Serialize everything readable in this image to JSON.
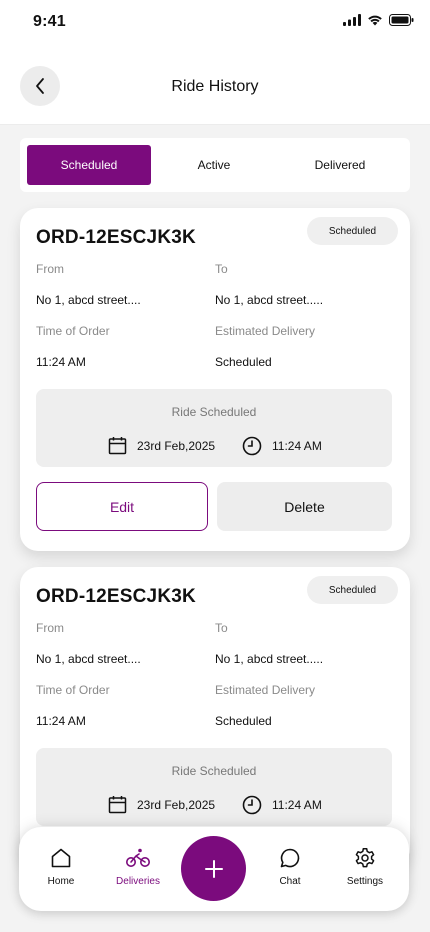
{
  "status_bar": {
    "time": "9:41"
  },
  "header": {
    "title": "Ride History"
  },
  "tabs": [
    {
      "label": "Scheduled",
      "active": true
    },
    {
      "label": "Active",
      "active": false
    },
    {
      "label": "Delivered",
      "active": false
    }
  ],
  "orders": [
    {
      "id": "ORD-12ESCJK3K",
      "status": "Scheduled",
      "from_label": "From",
      "from_value": "No 1, abcd street....",
      "to_label": "To",
      "to_value": "No 1, abcd street.....",
      "time_label": "Time of Order",
      "time_value": "11:24 AM",
      "delivery_label": "Estimated Delivery",
      "delivery_value": "Scheduled",
      "schedule_title": "Ride Scheduled",
      "schedule_date": "23rd Feb,2025",
      "schedule_time": "11:24 AM",
      "edit_label": "Edit",
      "delete_label": "Delete"
    },
    {
      "id": "ORD-12ESCJK3K",
      "status": "Scheduled",
      "from_label": "From",
      "from_value": "No 1, abcd street....",
      "to_label": "To",
      "to_value": "No 1, abcd street.....",
      "time_label": "Time of Order",
      "time_value": "11:24 AM",
      "delivery_label": "Estimated Delivery",
      "delivery_value": "Scheduled",
      "schedule_title": "Ride Scheduled",
      "schedule_date": "23rd Feb,2025",
      "schedule_time": "11:24 AM"
    }
  ],
  "nav": [
    {
      "label": "Home",
      "icon": "home-icon",
      "active": false
    },
    {
      "label": "Deliveries",
      "icon": "bicycle-icon",
      "active": true
    },
    {
      "label": "Chat",
      "icon": "chat-icon",
      "active": false
    },
    {
      "label": "Settings",
      "icon": "gear-icon",
      "active": false
    }
  ],
  "colors": {
    "accent": "#7b0b7d"
  }
}
